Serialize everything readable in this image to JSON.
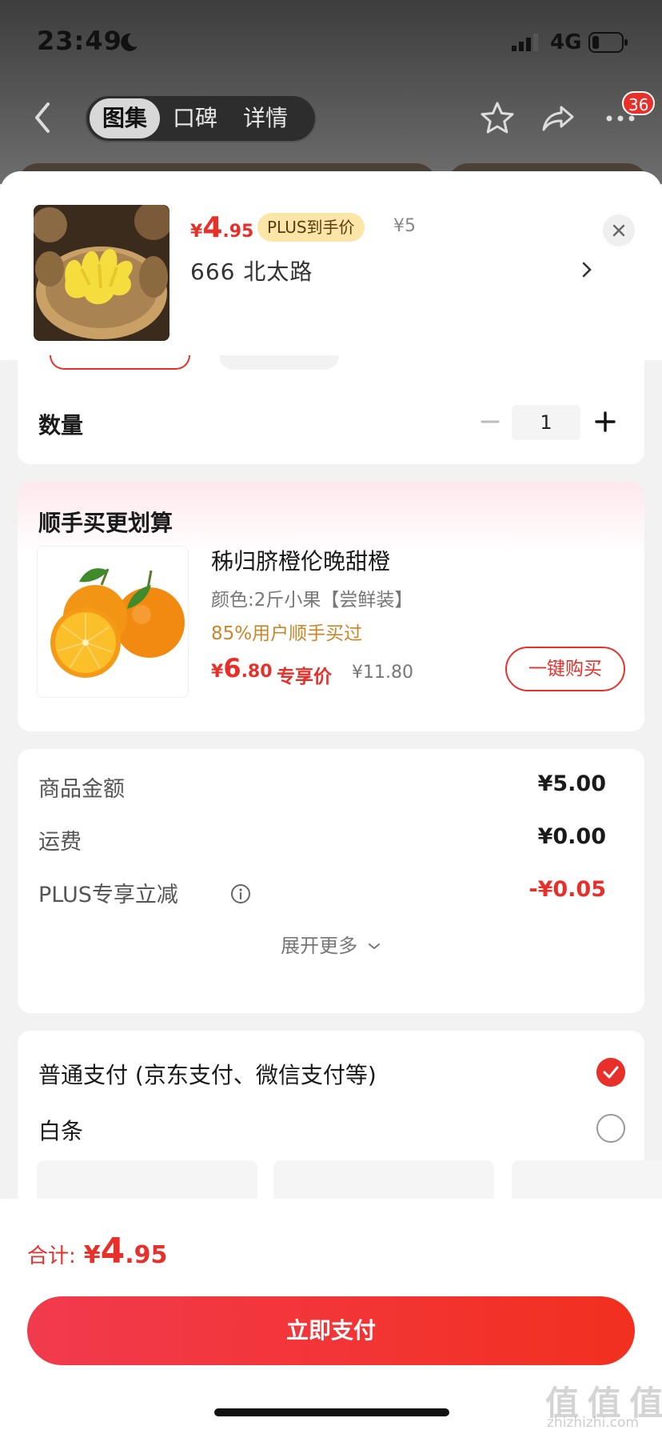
{
  "status_bar": {
    "time": "23:49",
    "network": "4G"
  },
  "nav": {
    "tabs": [
      {
        "label": "图集"
      },
      {
        "label": "口碑"
      },
      {
        "label": "详情"
      }
    ],
    "badge_count": "36"
  },
  "product": {
    "price_currency": "¥",
    "price_int": "4",
    "price_dec": ".95",
    "plus_tag": "PLUS到手价",
    "original_price": "¥5",
    "address": "666  北太路"
  },
  "quantity": {
    "label": "数量",
    "value": "1"
  },
  "bundle": {
    "title": "顺手买更划算",
    "item_name": "秭归脐橙伦晚甜橙",
    "item_spec": "颜色:2斤小果【尝鲜装】",
    "social_proof": "85%用户顺手买过",
    "price_currency": "¥",
    "price_int": "6",
    "price_dec": ".80",
    "price_tag": "专享价",
    "original_price": "¥11.80",
    "buy_button": "一键购买"
  },
  "summary": {
    "rows": [
      {
        "label": "商品金额",
        "value": "¥5.00"
      },
      {
        "label": "运费",
        "value": "¥0.00"
      },
      {
        "label": "PLUS专享立减",
        "value": "-¥0.05"
      }
    ],
    "expand_label": "展开更多"
  },
  "payment": {
    "options": [
      {
        "label": "普通支付 (京东支付、微信支付等)",
        "selected": true
      },
      {
        "label": "白条",
        "selected": false
      }
    ]
  },
  "footer": {
    "total_label": "合计:",
    "total_currency": "¥",
    "total_int": "4",
    "total_dec": ".95",
    "pay_button": "立即支付"
  },
  "watermark": {
    "main": "值 值 值",
    "sub": "zhizhizhi.com"
  },
  "colors": {
    "accent": "#e8302a",
    "plus_tag_bg": "#fbe6a8",
    "social_proof": "#c8862a"
  }
}
